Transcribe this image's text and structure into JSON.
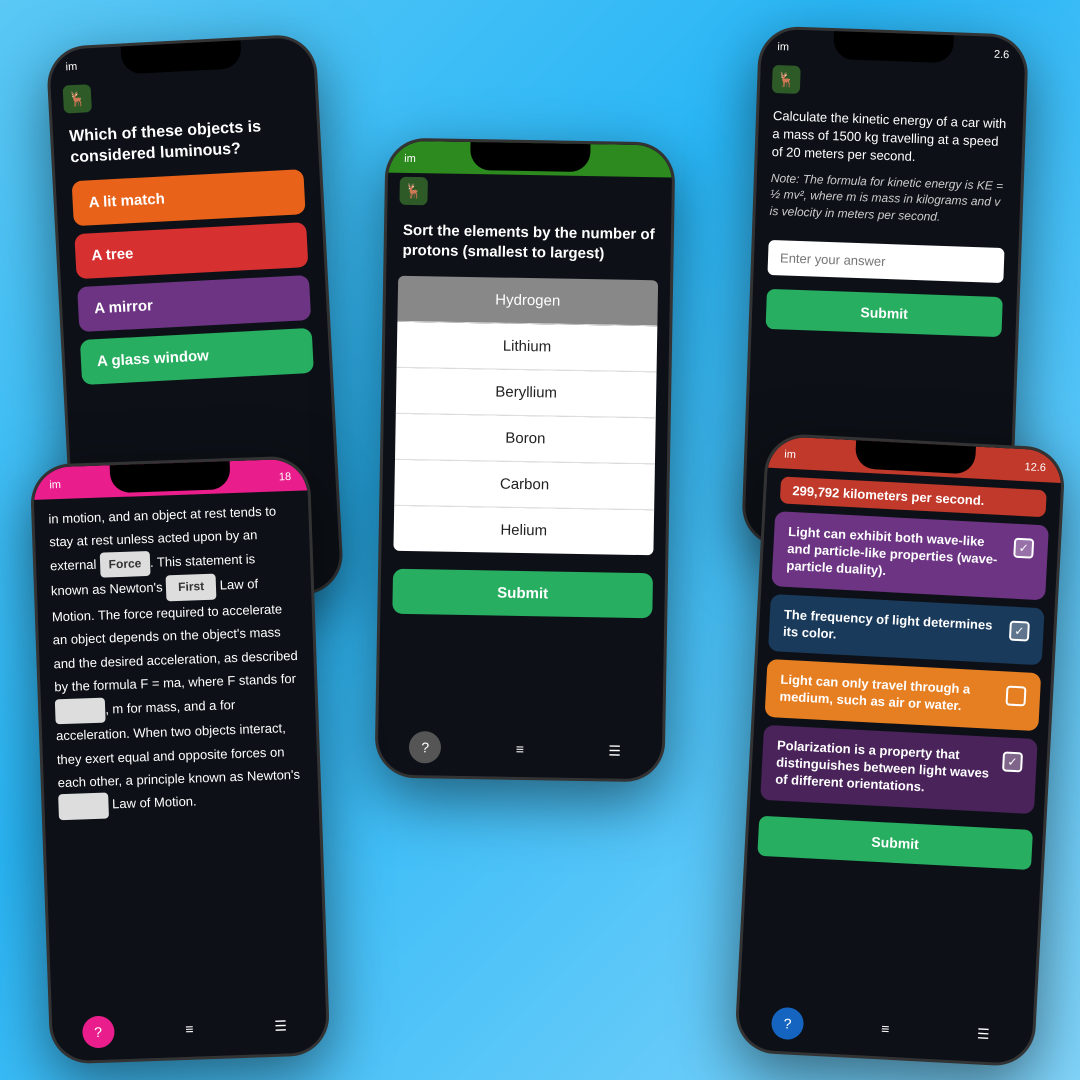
{
  "background": "#5bc8f5",
  "phone1": {
    "status_left": "im",
    "status_right": "",
    "question": "Which of these objects is considered luminous?",
    "answers": [
      {
        "text": "A lit match",
        "color": "btn-orange"
      },
      {
        "text": "A tree",
        "color": "btn-red"
      },
      {
        "text": "A mirror",
        "color": "btn-purple"
      },
      {
        "text": "A glass window",
        "color": "btn-green"
      }
    ]
  },
  "phone2": {
    "status_left": "im",
    "status_right": "",
    "question": "Sort the elements by the number of protons (smallest to largest)",
    "elements": [
      "Hydrogen",
      "Lithium",
      "Beryllium",
      "Boron",
      "Carbon",
      "Helium"
    ],
    "submit_label": "Submit"
  },
  "phone3": {
    "status_left": "im",
    "status_right": "2.6",
    "question": "Calculate the kinetic energy of a car with a mass of 1500 kg travelling at a speed of 20 meters per second.",
    "note": "Note: The formula for kinetic energy is KE = ½ mv², where m is mass in kilograms and v is velocity in meters per second.",
    "input_placeholder": "Enter your answer",
    "submit_label": "Submit"
  },
  "phone4": {
    "status_left": "im",
    "status_right": "18",
    "text_parts": [
      "in motion, and an object at rest tends to stay at rest unless acted upon by an external",
      "Force",
      ". This statement is known as Newton's",
      "First",
      "Law of Motion. The force required to accelerate an object depends on the object's mass and the desired acceleration, as described by the formula F = ma, where F stands for",
      "",
      ", m for mass, and a for acceleration. When two objects interact, they exert equal and opposite forces on each other, a principle known as Newton's",
      "",
      "Law of Motion."
    ]
  },
  "phone5": {
    "status_left": "im",
    "status_right": "12.6",
    "speed_text": "299,792 kilometers per second.",
    "items": [
      {
        "text": "Light can exhibit both wave-like and particle-like properties (wave-particle duality).",
        "color": "item-purple",
        "checked": true
      },
      {
        "text": "The frequency of light determines its color.",
        "color": "item-white-text",
        "checked": true
      },
      {
        "text": "Light can only travel through a medium, such as air or water.",
        "color": "item-orange",
        "checked": false
      },
      {
        "text": "Polarization is a property that distinguishes between light waves of different orientations.",
        "color": "item-dark-purple",
        "checked": true
      }
    ],
    "submit_label": "Submit"
  }
}
